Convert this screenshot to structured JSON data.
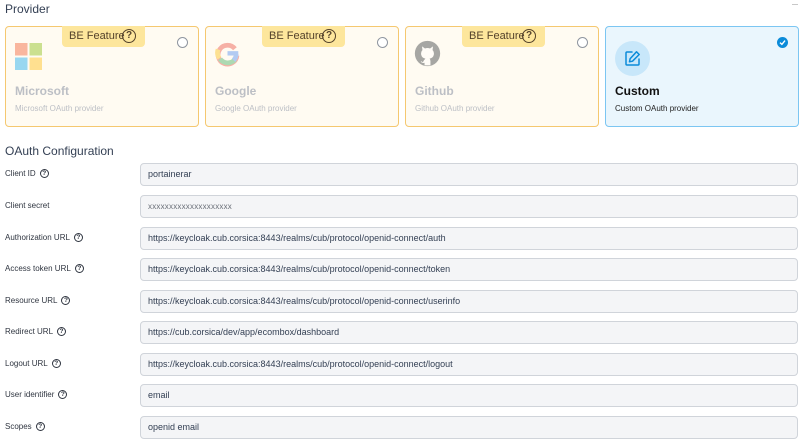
{
  "provider": {
    "title": "Provider",
    "badge_label": "BE Feature",
    "badge_icon": "?",
    "cards": [
      {
        "id": "microsoft",
        "name": "Microsoft",
        "desc": "Microsoft OAuth provider",
        "selected": false,
        "locked": true,
        "icon": "microsoft-icon"
      },
      {
        "id": "google",
        "name": "Google",
        "desc": "Google OAuth provider",
        "selected": false,
        "locked": true,
        "icon": "google-icon"
      },
      {
        "id": "github",
        "name": "Github",
        "desc": "Github OAuth provider",
        "selected": false,
        "locked": true,
        "icon": "github-icon"
      },
      {
        "id": "custom",
        "name": "Custom",
        "desc": "Custom OAuth provider",
        "selected": true,
        "locked": false,
        "icon": "edit-icon"
      }
    ]
  },
  "oauth": {
    "title": "OAuth Configuration",
    "help_icon": "?",
    "fields": [
      {
        "label": "Client ID",
        "value": "portainerar",
        "has_help": true
      },
      {
        "label": "Client secret",
        "value": "xxxxxxxxxxxxxxxxxxxx",
        "has_help": false
      },
      {
        "label": "Authorization URL",
        "value": "https://keycloak.cub.corsica:8443/realms/cub/protocol/openid-connect/auth",
        "has_help": true
      },
      {
        "label": "Access token URL",
        "value": "https://keycloak.cub.corsica:8443/realms/cub/protocol/openid-connect/token",
        "has_help": true
      },
      {
        "label": "Resource URL",
        "value": "https://keycloak.cub.corsica:8443/realms/cub/protocol/openid-connect/userinfo",
        "has_help": true
      },
      {
        "label": "Redirect URL",
        "value": "https://cub.corsica/dev/app/ecombox/dashboard",
        "has_help": true
      },
      {
        "label": "Logout URL",
        "value": "https://keycloak.cub.corsica:8443/realms/cub/protocol/openid-connect/logout",
        "has_help": true
      },
      {
        "label": "User identifier",
        "value": "email",
        "has_help": true
      },
      {
        "label": "Scopes",
        "value": "openid email",
        "has_help": true
      }
    ]
  },
  "colors": {
    "badge_bg": "#fde69c",
    "locked_border": "#f5c870",
    "selected_border": "#7cc6f2",
    "selected_bg": "#eaf6fd",
    "accent": "#0b8bd9"
  }
}
